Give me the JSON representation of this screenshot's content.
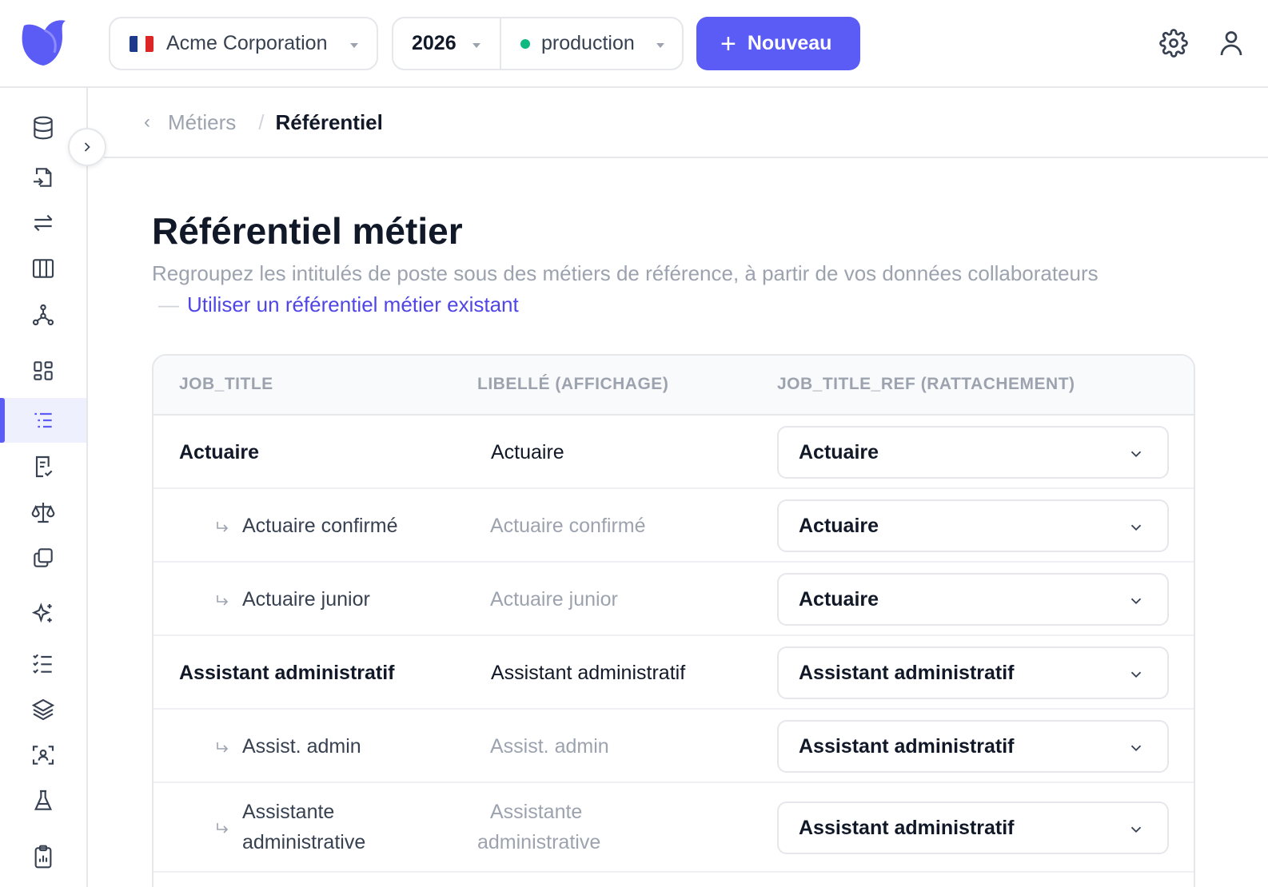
{
  "header": {
    "organization": "Acme Corporation",
    "year": "2026",
    "environment": "production",
    "new_button_label": "Nouveau",
    "accent_color": "#5b5bf6",
    "env_status_color": "#10b981"
  },
  "breadcrumb": {
    "parent": "Métiers",
    "separator": "/",
    "current": "Référentiel"
  },
  "page": {
    "title": "Référentiel métier",
    "description": "Regroupez les intitulés de poste sous des métiers de référence, à partir de vos données collaborateurs",
    "dash": "—",
    "link_label": "Utiliser un référentiel métier existant"
  },
  "table": {
    "columns": [
      "JOB_TITLE",
      "LIBELLÉ (AFFICHAGE)",
      "JOB_TITLE_REF (RATTACHEMENT)"
    ],
    "rows": [
      {
        "job_title": "Actuaire",
        "libelle": "Actuaire",
        "ref": "Actuaire",
        "level": "parent"
      },
      {
        "job_title": "Actuaire confirmé",
        "libelle": "Actuaire confirmé",
        "ref": "Actuaire",
        "level": "child"
      },
      {
        "job_title": "Actuaire junior",
        "libelle": "Actuaire junior",
        "ref": "Actuaire",
        "level": "child"
      },
      {
        "job_title": "Assistant administratif",
        "libelle": "Assistant administratif",
        "ref": "Assistant administratif",
        "level": "parent"
      },
      {
        "job_title": "Assist. admin",
        "libelle": "Assist. admin",
        "ref": "Assistant administratif",
        "level": "child"
      },
      {
        "job_title": "Assistante administrative",
        "libelle": "Assistante administrative",
        "ref": "Assistant administratif",
        "level": "child"
      }
    ]
  },
  "sidebar": {
    "icons": [
      "database-icon",
      "file-import-icon",
      "transfer-icon",
      "columns-icon",
      "graph-icon",
      "dashboard-icon",
      "list-tree-icon",
      "file-check-icon",
      "scale-icon",
      "copy-icon",
      "sparkles-icon",
      "checklist-icon",
      "layers-icon",
      "user-scan-icon",
      "flask-icon",
      "clipboard-chart-icon"
    ],
    "active_index": 6
  }
}
